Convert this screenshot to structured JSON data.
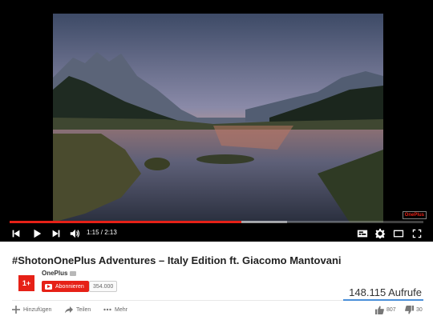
{
  "player": {
    "current_time": "1:15",
    "duration": "2:13",
    "time_display": "1:15 / 2:13",
    "progress_played": 0.56,
    "progress_loaded": 0.67,
    "watermark": "OnePlus",
    "colors": {
      "accent": "#e62117",
      "background": "#000000"
    },
    "icons": [
      "previous-icon",
      "play-icon",
      "next-icon",
      "volume-icon",
      "subtitles-icon",
      "settings-icon",
      "miniplayer-icon",
      "fullscreen-icon"
    ]
  },
  "video": {
    "title": "#ShotonOnePlus Adventures – Italy Edition ft. Giacomo Mantovani",
    "channel_name": "OnePlus",
    "avatar_text": "1+",
    "subscribe_label": "Abonnieren",
    "subscriber_count": "354.000",
    "views": "148.115 Aufrufe"
  },
  "actions": {
    "add_label": "Hinzufügen",
    "share_label": "Teilen",
    "more_label": "Mehr",
    "likes": "807",
    "dislikes": "30"
  }
}
